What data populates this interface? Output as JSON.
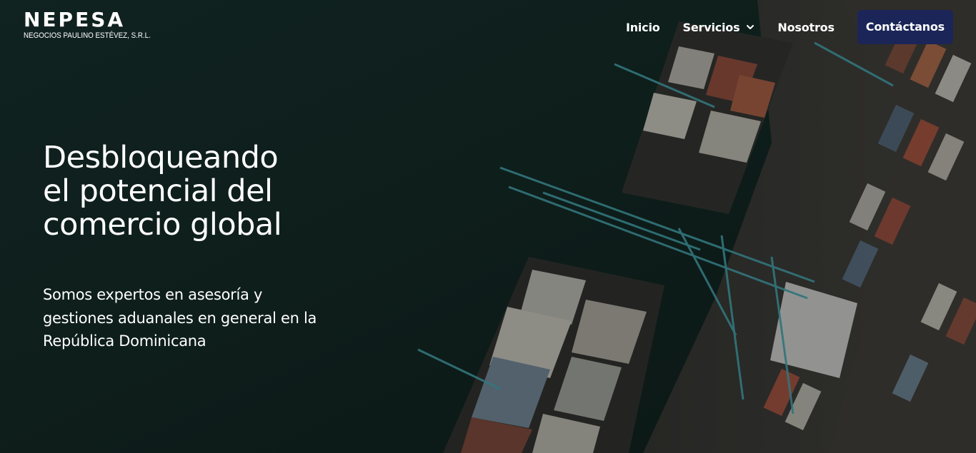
{
  "brand": {
    "name": "NEPESA",
    "tagline": "NEGOCIOS PAULINO ESTÉVEZ, S.R.L."
  },
  "nav": {
    "items": [
      {
        "label": "Inicio"
      },
      {
        "label": "Servicios",
        "icon": "chevron-down-icon"
      },
      {
        "label": "Nosotros"
      }
    ],
    "cta_label": "Contáctanos"
  },
  "hero": {
    "headline_lines": [
      "Desbloqueando",
      "el potencial del",
      "comercio global"
    ],
    "subtext": "Somos expertos en asesoría y gestiones aduanales en general en la República Dominicana",
    "background_image": "aerial-port-container-ship-image"
  },
  "colors": {
    "cta_background": "#1b2558",
    "sea": "#122725",
    "text": "#ffffff"
  }
}
